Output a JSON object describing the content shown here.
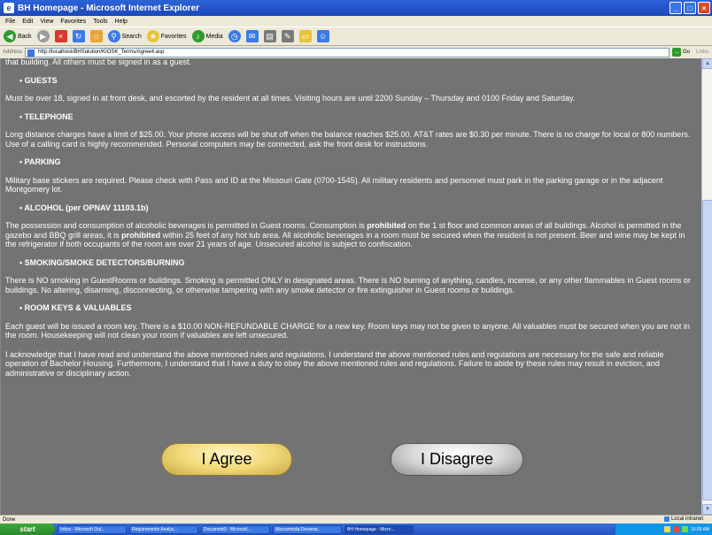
{
  "window": {
    "title": "BH Homepage - Microsoft Internet Explorer"
  },
  "menu": [
    "File",
    "Edit",
    "View",
    "Favorites",
    "Tools",
    "Help"
  ],
  "toolbar": {
    "back": "Back",
    "search": "Search",
    "favorites": "Favorites",
    "media": "Media"
  },
  "address": {
    "label": "Address",
    "url": "http://localhost/BHSolution/KIOSK_Terms/Agree4.asp",
    "go": "Go",
    "links": "Links"
  },
  "content": {
    "intro": "that building. All others must be signed in as a guest.",
    "sections": [
      {
        "heading": "GUESTS",
        "text": "Must be over 18, signed in at front desk, and escorted by the resident at all times. Visiting hours are until 2200 Sunday – Thursday and 0100 Friday and Saturday."
      },
      {
        "heading": "TELEPHONE",
        "text": "Long distance charges have a limit of $25.00. Your phone access will be shut off when the balance reaches $25.00. AT&T rates are $0.30 per minute. There is no charge for local or 800 numbers. Use of a calling card is highly recommended. Personal computers may be connected, ask the front desk for instructions."
      },
      {
        "heading": "PARKING",
        "text": "Military base stickers are required. Please check with Pass and ID at the Missouri Gate (0700-1545). All military residents and personnel must park in the parking garage or in the adjacent Montgomery lot."
      },
      {
        "heading": "ALCOHOL (per OPNAV 11103.1b)",
        "text_a": "The possession and consumption of alcoholic beverages is permitted in Guest rooms. Consumption is ",
        "bold_a": "prohibited",
        "text_b": " on the 1 st floor and common areas of all buildings. Alcohol is permitted in the gazebo and BBQ grill areas, it is ",
        "bold_b": "prohibited",
        "text_c": " within 25 feet of any hot tub area. All alcoholic beverages in a room must be secured when the resident is not present. Beer and wine may be kept in the refrigerator if both occupants of the room are over 21 years of age. Unsecured alcohol is subject to confiscation."
      },
      {
        "heading": "SMOKING/SMOKE DETECTORS/BURNING",
        "text": "There is NO smoking in GuestRooms or buildings. Smoking is permitted ONLY in designated areas. There is NO burning of anything, candles, incense, or any other flammables in Guest rooms or buildings. No altering, disarming, disconnecting, or otherwise tampering with any smoke detector or fire extinguisher in Guest rooms or buildings."
      },
      {
        "heading": "ROOM KEYS & VALUABLES",
        "text": "Each guest will be issued a room key. There is a $10.00 NON-REFUNDABLE CHARGE for a new key. Room keys may not be given to anyone. All valuables must be secured when you are not in the room. Housekeeping will not clean your room if valuables are left unsecured."
      }
    ],
    "acknowledgement": "I acknowledge that I have read and understand the above mentioned rules and regulations. I understand the above mentioned rules and regulations are necessary for the safe and reliable operation of Bachelor Housing. Furthermore, I understand that I have a duty to obey the above mentioned rules and regulations. Failure to abide by these rules may result in eviction, and administrative or disciplinary action.",
    "agree_label": "I Agree",
    "disagree_label": "I Disagree"
  },
  "status": {
    "left": "Done",
    "zone": "Local intranet"
  },
  "taskbar": {
    "start": "start",
    "tasks": [
      "Inbox - Microsoft Out...",
      "Requirements Analys...",
      "Document3 - Microsof...",
      "Macromedia Dreamw...",
      "BH Homepage - Micro..."
    ],
    "clock": "10:35 AM"
  }
}
